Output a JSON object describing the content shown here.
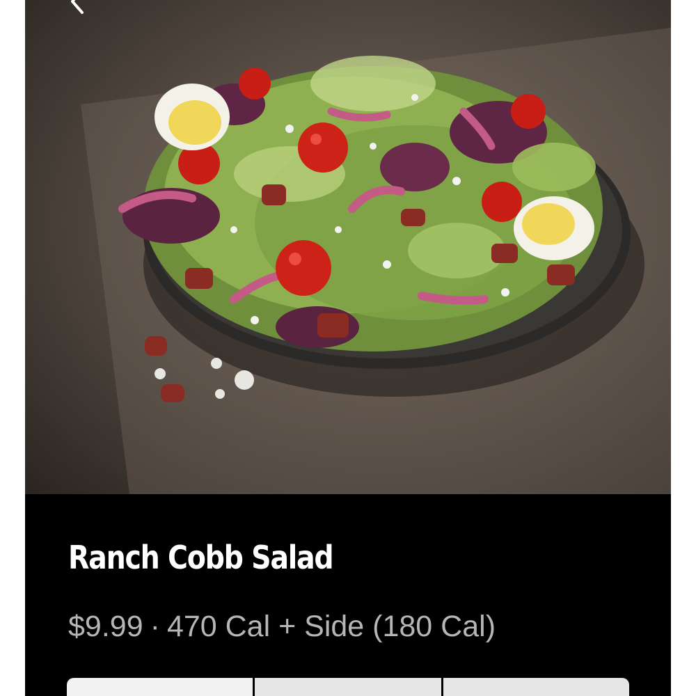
{
  "product": {
    "name": "Ranch Cobb Salad",
    "price": "$9.99",
    "separator": "·",
    "calories_text": "470 Cal + Side (180 Cal)",
    "image_alt": "salad-photo"
  },
  "navigation": {
    "back_icon": "chevron-left-icon"
  },
  "tabs": {
    "count": 3,
    "active_index": 0
  },
  "colors": {
    "background": "#000000",
    "title": "#ffffff",
    "meta": "#b6b6b6",
    "tab": "#e6e6e6"
  }
}
